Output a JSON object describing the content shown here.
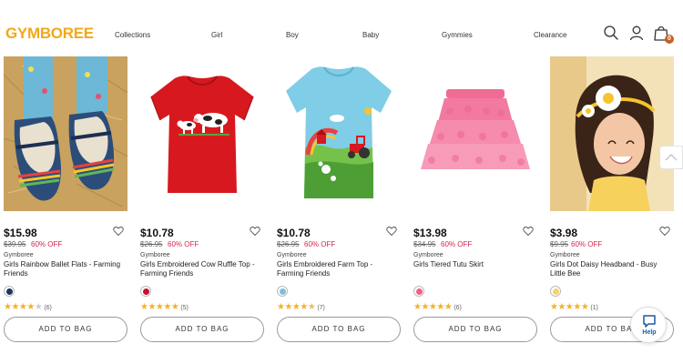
{
  "brand": {
    "logo": "GYMBOREE"
  },
  "nav": [
    "Collections",
    "Girl",
    "Boy",
    "Baby",
    "Gymmies",
    "Clearance"
  ],
  "header_icons": {
    "search": "search-icon",
    "account": "user-icon",
    "cart": "bag-icon",
    "cart_count": "0"
  },
  "products": [
    {
      "price": "$15.98",
      "original_price": "$39.95",
      "discount": "60% OFF",
      "brand": "Gymboree",
      "name": "Girls Rainbow Ballet Flats - Farming Friends",
      "swatch_color": "#1f3460",
      "rating": 4,
      "reviews": "(6)",
      "button": "ADD TO BAG"
    },
    {
      "price": "$10.78",
      "original_price": "$26.95",
      "discount": "60% OFF",
      "brand": "Gymboree",
      "name": "Girls Embroidered Cow Ruffle Top - Farming Friends",
      "swatch_color": "#c8102e",
      "rating": 5,
      "reviews": "(5)",
      "button": "ADD TO BAG"
    },
    {
      "price": "$10.78",
      "original_price": "$26.95",
      "discount": "60% OFF",
      "brand": "Gymboree",
      "name": "Girls Embroidered Farm Top - Farming Friends",
      "swatch_color": "#7cc0d8",
      "rating": 4.5,
      "reviews": "(7)",
      "button": "ADD TO BAG"
    },
    {
      "price": "$13.98",
      "original_price": "$34.95",
      "discount": "60% OFF",
      "brand": "Gymboree",
      "name": "Girls Tiered Tutu Skirt",
      "swatch_color": "#ef5f86",
      "rating": 5,
      "reviews": "(6)",
      "button": "ADD TO BAG"
    },
    {
      "price": "$3.98",
      "original_price": "$9.95",
      "discount": "60% OFF",
      "brand": "Gymboree",
      "name": "Girls Dot Daisy Headband - Busy Little Bee",
      "swatch_color": "#f3d36b",
      "rating": 5,
      "reviews": "(1)",
      "button": "ADD TO BAG"
    }
  ],
  "help": {
    "label": "Help"
  },
  "colors": {
    "logo": "#f2a818",
    "sale": "#d6244e",
    "star": "#f2b22b",
    "cart_badge": "#c8601e"
  }
}
